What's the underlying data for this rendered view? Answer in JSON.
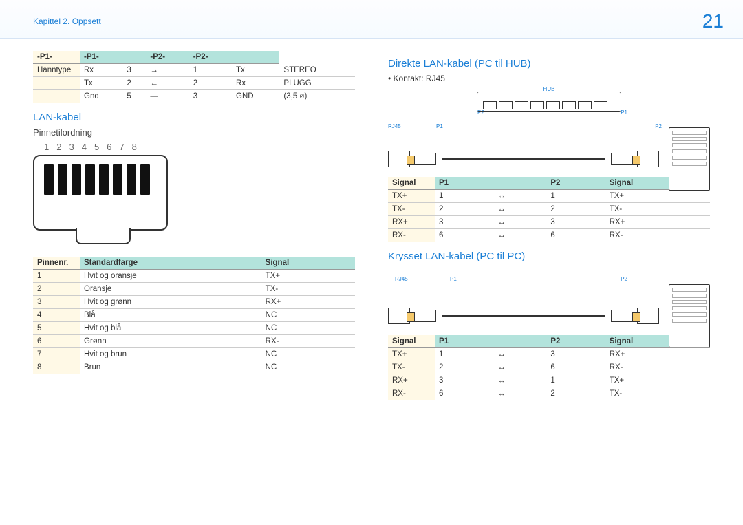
{
  "header": {
    "chapter": "Kapittel 2. Oppsett",
    "page": "21"
  },
  "table1": {
    "head": [
      "-P1-",
      "-P1-",
      "",
      "-P2-",
      "-P2-",
      ""
    ],
    "rows": [
      [
        "Hanntype",
        "Rx",
        "3",
        "→",
        "1",
        "Tx",
        "STEREO"
      ],
      [
        "",
        "Tx",
        "2",
        "←",
        "2",
        "Rx",
        "PLUGG"
      ],
      [
        "",
        "Gnd",
        "5",
        "—",
        "3",
        "GND",
        "(3,5 ø)"
      ]
    ]
  },
  "lan": {
    "title": "LAN-kabel",
    "sub": "Pinnetilordning",
    "pins": [
      "1",
      "2",
      "3",
      "4",
      "5",
      "6",
      "7",
      "8"
    ]
  },
  "table2": {
    "head": [
      "Pinnenr.",
      "Standardfarge",
      "Signal"
    ],
    "rows": [
      [
        "1",
        "Hvit og oransje",
        "TX+"
      ],
      [
        "2",
        "Oransje",
        "TX-"
      ],
      [
        "3",
        "Hvit og grønn",
        "RX+"
      ],
      [
        "4",
        "Blå",
        "NC"
      ],
      [
        "5",
        "Hvit og blå",
        "NC"
      ],
      [
        "6",
        "Grønn",
        "RX-"
      ],
      [
        "7",
        "Hvit og brun",
        "NC"
      ],
      [
        "8",
        "Brun",
        "NC"
      ]
    ]
  },
  "direct": {
    "title": "Direkte LAN-kabel (PC til HUB)",
    "bullet": "Kontakt: RJ45",
    "labels": {
      "hub": "HUB",
      "rj45": "RJ45",
      "p1": "P1",
      "p2": "P2"
    }
  },
  "table3": {
    "head": [
      "Signal",
      "P1",
      "",
      "P2",
      "Signal"
    ],
    "rows": [
      [
        "TX+",
        "1",
        "↔",
        "1",
        "TX+"
      ],
      [
        "TX-",
        "2",
        "↔",
        "2",
        "TX-"
      ],
      [
        "RX+",
        "3",
        "↔",
        "3",
        "RX+"
      ],
      [
        "RX-",
        "6",
        "↔",
        "6",
        "RX-"
      ]
    ]
  },
  "cross": {
    "title": "Krysset LAN-kabel (PC til PC)",
    "labels": {
      "rj45": "RJ45",
      "p1": "P1",
      "p2": "P2"
    }
  },
  "table4": {
    "head": [
      "Signal",
      "P1",
      "",
      "P2",
      "Signal"
    ],
    "rows": [
      [
        "TX+",
        "1",
        "↔",
        "3",
        "RX+"
      ],
      [
        "TX-",
        "2",
        "↔",
        "6",
        "RX-"
      ],
      [
        "RX+",
        "3",
        "↔",
        "1",
        "TX+"
      ],
      [
        "RX-",
        "6",
        "↔",
        "2",
        "TX-"
      ]
    ]
  }
}
